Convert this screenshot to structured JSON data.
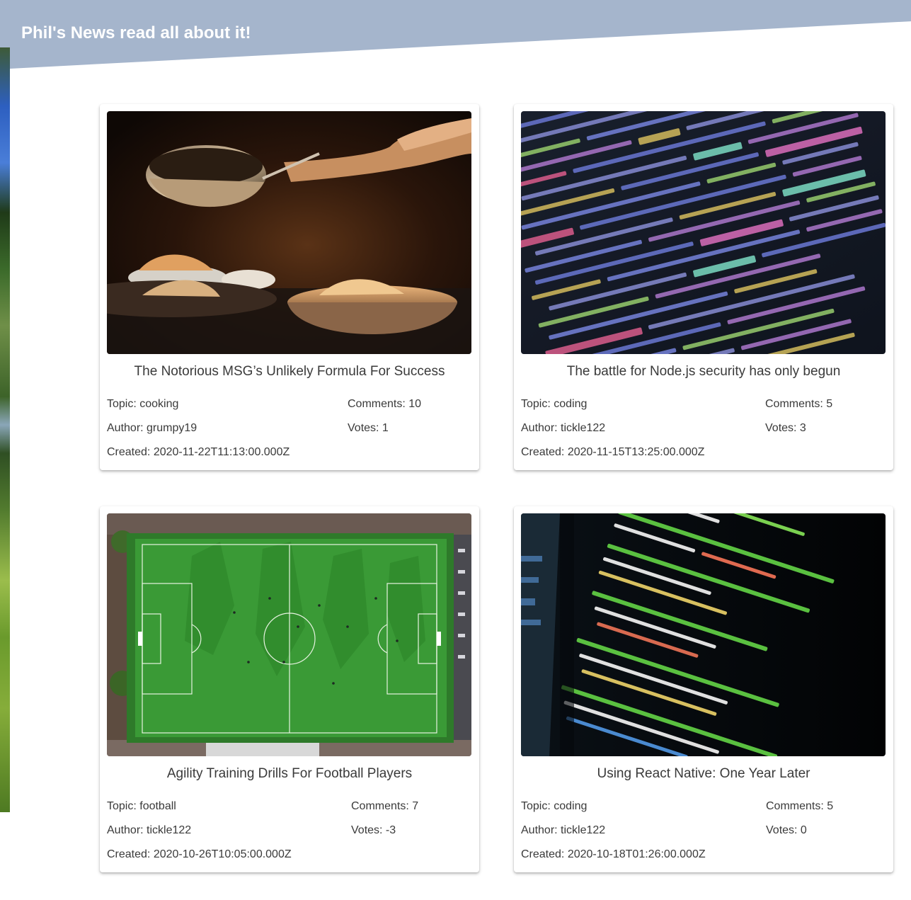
{
  "header": {
    "title": "Phil's News read all about it!"
  },
  "articles": [
    {
      "title": "The Notorious MSG’s Unlikely Formula For Success",
      "topic": "Topic: cooking",
      "author": "Author: grumpy19",
      "created": "Created: 2020-11-22T11:13:00.000Z",
      "comments": "Comments: 10",
      "votes": "Votes: 1",
      "image": "cooking-photo"
    },
    {
      "title": "The battle for Node.js security has only begun",
      "topic": "Topic: coding",
      "author": "Author: tickle122",
      "created": "Created: 2020-11-15T13:25:00.000Z",
      "comments": "Comments: 5",
      "votes": "Votes: 3",
      "image": "code-screen-photo"
    },
    {
      "title": "Agility Training Drills For Football Players",
      "topic": "Topic: football",
      "author": "Author: tickle122",
      "created": "Created: 2020-10-26T10:05:00.000Z",
      "comments": "Comments: 7",
      "votes": "Votes: -3",
      "image": "football-pitch-photo"
    },
    {
      "title": "Using React Native: One Year Later",
      "topic": "Topic: coding",
      "author": "Author: tickle122",
      "created": "Created: 2020-10-18T01:26:00.000Z",
      "comments": "Comments: 5",
      "votes": "Votes: 0",
      "image": "code-terminal-photo"
    }
  ],
  "colors": {
    "header": "#a5b5cc",
    "header_text": "#ffffff",
    "card_text": "#3a3a3a"
  }
}
